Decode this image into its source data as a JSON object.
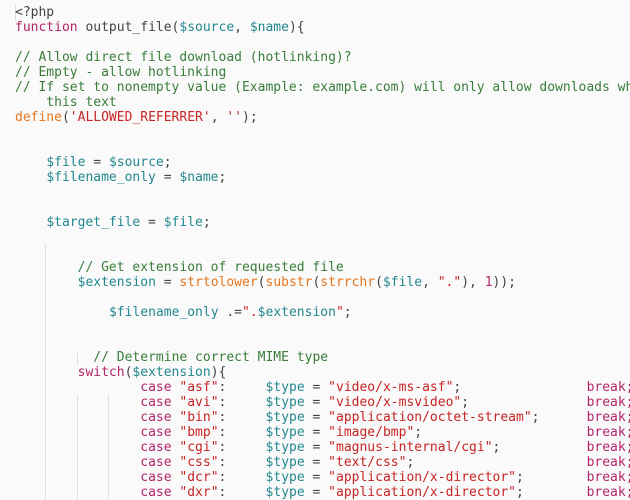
{
  "editor": {
    "language": "php",
    "colors": {
      "background": "#fafafa",
      "keyword": "#b3256b",
      "variable": "#22888f",
      "comment": "#3a7d3a",
      "function": "#e8751a",
      "string": "#c72424",
      "plain": "#444444"
    },
    "lines": [
      {
        "row": 0,
        "indent": 0,
        "tokens": [
          {
            "t": "pl",
            "v": "<?php"
          }
        ]
      },
      {
        "row": 1,
        "indent": 0,
        "tokens": [
          {
            "t": "kw",
            "v": "function"
          },
          {
            "t": "pl",
            "v": " output_file("
          },
          {
            "t": "var",
            "v": "$source"
          },
          {
            "t": "pl",
            "v": ", "
          },
          {
            "t": "var",
            "v": "$name"
          },
          {
            "t": "pl",
            "v": "){"
          }
        ]
      },
      {
        "row": 3,
        "indent": 0,
        "tokens": [
          {
            "t": "cm",
            "v": "// Allow direct file download (hotlinking)?"
          }
        ]
      },
      {
        "row": 4,
        "indent": 0,
        "tokens": [
          {
            "t": "cm",
            "v": "// Empty - allow hotlinking"
          }
        ]
      },
      {
        "row": 5,
        "indent": 0,
        "tokens": [
          {
            "t": "cm",
            "v": "// If set to nonempty value (Example: example.com) will only allow downloads when referrer contains"
          }
        ]
      },
      {
        "row": 6,
        "indent": 0,
        "tokens": [
          {
            "t": "cm",
            "v": "    this text"
          }
        ]
      },
      {
        "row": 7,
        "indent": 0,
        "tokens": [
          {
            "t": "fn",
            "v": "define"
          },
          {
            "t": "pl",
            "v": "("
          },
          {
            "t": "str",
            "v": "'ALLOWED_REFERRER'"
          },
          {
            "t": "pl",
            "v": ", "
          },
          {
            "t": "str",
            "v": "''"
          },
          {
            "t": "pl",
            "v": ");"
          }
        ]
      },
      {
        "row": 10,
        "indent": 4,
        "tokens": [
          {
            "t": "var",
            "v": "$file"
          },
          {
            "t": "pl",
            "v": " = "
          },
          {
            "t": "var",
            "v": "$source"
          },
          {
            "t": "pl",
            "v": ";"
          }
        ]
      },
      {
        "row": 11,
        "indent": 4,
        "tokens": [
          {
            "t": "var",
            "v": "$filename_only"
          },
          {
            "t": "pl",
            "v": " = "
          },
          {
            "t": "var",
            "v": "$name"
          },
          {
            "t": "pl",
            "v": ";"
          }
        ]
      },
      {
        "row": 14,
        "indent": 4,
        "tokens": [
          {
            "t": "var",
            "v": "$target_file"
          },
          {
            "t": "pl",
            "v": " = "
          },
          {
            "t": "var",
            "v": "$file"
          },
          {
            "t": "pl",
            "v": ";"
          }
        ]
      },
      {
        "row": 17,
        "indent": 8,
        "tokens": [
          {
            "t": "cm",
            "v": "// Get extension of requested file"
          }
        ]
      },
      {
        "row": 18,
        "indent": 8,
        "tokens": [
          {
            "t": "var",
            "v": "$extension"
          },
          {
            "t": "pl",
            "v": " = "
          },
          {
            "t": "fn",
            "v": "strtolower"
          },
          {
            "t": "pl",
            "v": "("
          },
          {
            "t": "fn",
            "v": "substr"
          },
          {
            "t": "pl",
            "v": "("
          },
          {
            "t": "fn",
            "v": "strrchr"
          },
          {
            "t": "pl",
            "v": "("
          },
          {
            "t": "var",
            "v": "$file"
          },
          {
            "t": "pl",
            "v": ", "
          },
          {
            "t": "str",
            "v": "\".\""
          },
          {
            "t": "pl",
            "v": "), "
          },
          {
            "t": "num",
            "v": "1"
          },
          {
            "t": "pl",
            "v": "));"
          }
        ]
      },
      {
        "row": 20,
        "indent": 12,
        "tokens": [
          {
            "t": "var",
            "v": "$filename_only"
          },
          {
            "t": "pl",
            "v": " .="
          },
          {
            "t": "str",
            "v": "\"."
          },
          {
            "t": "var",
            "v": "$extension"
          },
          {
            "t": "str",
            "v": "\""
          },
          {
            "t": "pl",
            "v": ";"
          }
        ]
      },
      {
        "row": 23,
        "indent": 10,
        "tokens": [
          {
            "t": "cm",
            "v": "// Determine correct MIME type"
          }
        ]
      },
      {
        "row": 24,
        "indent": 8,
        "tokens": [
          {
            "t": "kw",
            "v": "switch"
          },
          {
            "t": "pl",
            "v": "("
          },
          {
            "t": "var",
            "v": "$extension"
          },
          {
            "t": "pl",
            "v": "){"
          }
        ]
      }
    ],
    "cases": [
      {
        "ext": "\"asf\"",
        "type": "\"video/x-ms-asf\""
      },
      {
        "ext": "\"avi\"",
        "type": "\"video/x-msvideo\""
      },
      {
        "ext": "\"bin\"",
        "type": "\"application/octet-stream\""
      },
      {
        "ext": "\"bmp\"",
        "type": "\"image/bmp\""
      },
      {
        "ext": "\"cgi\"",
        "type": "\"magnus-internal/cgi\""
      },
      {
        "ext": "\"css\"",
        "type": "\"text/css\""
      },
      {
        "ext": "\"dcr\"",
        "type": "\"application/x-director\""
      },
      {
        "ext": "\"dxr\"",
        "type": "\"application/x-director\""
      }
    ],
    "case_keyword": "case",
    "type_var": "$type",
    "break_keyword": "break;"
  }
}
